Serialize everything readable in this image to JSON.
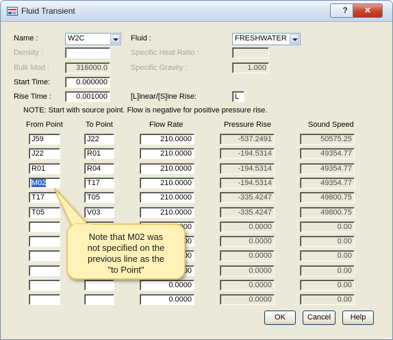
{
  "window": {
    "title": "Fluid Transient",
    "help_label": "?",
    "close_label": "✕"
  },
  "form": {
    "name_label": "Name  :",
    "name_value": "W2C",
    "fluid_label": "Fluid  :",
    "fluid_value": "FRESHWATER",
    "density_label": "Density  :",
    "density_value": "",
    "specific_heat_label": "Specific Heat Ratio :",
    "specific_heat_value": "",
    "bulk_mod_label": "Bulk Mod :",
    "bulk_mod_value": "316000.0",
    "specific_gravity_label": "Specific Gravity   :",
    "specific_gravity_value": "1.000",
    "start_time_label": "Start Time:",
    "start_time_value": "0.000000",
    "rise_time_label": "Rise Time :",
    "rise_time_value": "0.001000",
    "rise_type_label": "[L]inear/[S]ine Rise:",
    "rise_type_value": "L"
  },
  "note": "NOTE: Start with source point. Flow is negative for positive pressure rise.",
  "table": {
    "headers": [
      "From Point",
      "To Point",
      "Flow Rate",
      "Pressure Rise",
      "Sound Speed"
    ],
    "rows": [
      [
        "J59",
        "J22",
        "210.0000",
        "-537.2491",
        "50575.25"
      ],
      [
        "J22",
        "R01",
        "210.0000",
        "-194.5314",
        "49354.77"
      ],
      [
        "R01",
        "R04",
        "210.0000",
        "-194.5314",
        "49354.77"
      ],
      [
        "M02",
        "T17",
        "210.0000",
        "-194.5314",
        "49354.77"
      ],
      [
        "T17",
        "T05",
        "210.0000",
        "-335.4247",
        "49800.75"
      ],
      [
        "T05",
        "V03",
        "210.0000",
        "-335.4247",
        "49800.75"
      ],
      [
        "",
        "",
        "0.0000",
        "0.0000",
        "0.00"
      ],
      [
        "",
        "",
        "0.0000",
        "0.0000",
        "0.00"
      ],
      [
        "",
        "",
        "0.0000",
        "0.0000",
        "0.00"
      ],
      [
        "",
        "",
        "0.0000",
        "0.0000",
        "0.00"
      ],
      [
        "",
        "",
        "0.0000",
        "0.0000",
        "0.00"
      ],
      [
        "",
        "",
        "0.0000",
        "0.0000",
        "0.00"
      ]
    ]
  },
  "callout": {
    "lines": [
      "Note that M02 was",
      "not specified on the",
      "previous line as the",
      "\"to Point\""
    ]
  },
  "buttons": {
    "ok": "OK",
    "cancel": "Cancel",
    "help": "Help"
  },
  "colors": {
    "selection": "#3169c6",
    "callout_fill": "#fff2b8",
    "callout_border": "#e5c04a"
  }
}
